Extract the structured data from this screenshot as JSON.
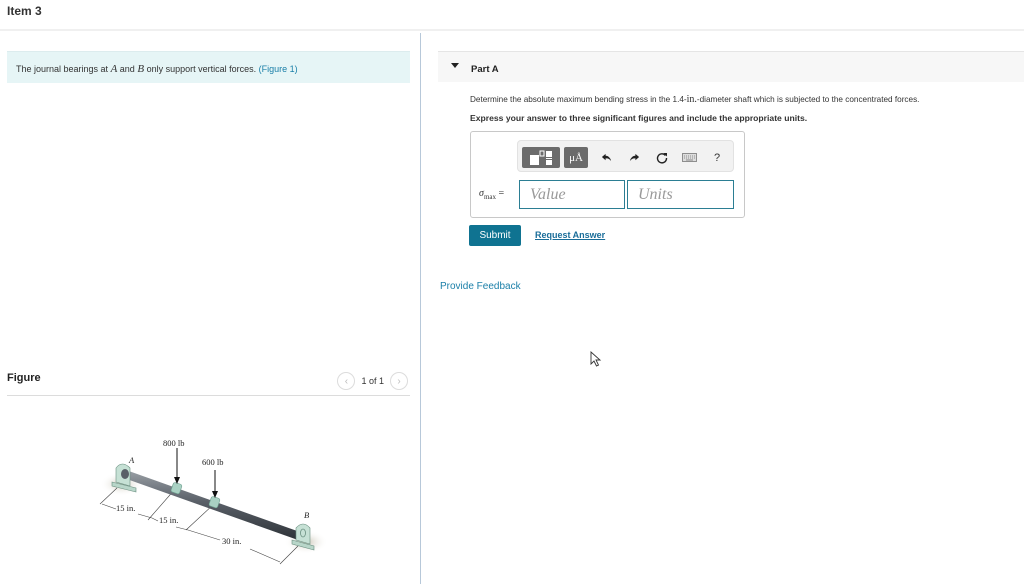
{
  "header": {
    "item_title": "Item 3"
  },
  "intro": {
    "text_before": "The journal bearings at ",
    "var_a": "A",
    "text_and": " and ",
    "var_b": "B",
    "text_after": " only support vertical forces. ",
    "figure_link": "(Figure 1)"
  },
  "figure_panel": {
    "title": "Figure",
    "pager_text": "1 of 1",
    "prev_icon": "chevron-left-icon",
    "next_icon": "chevron-right-icon",
    "labels": {
      "point_a": "A",
      "point_b": "B",
      "force_1": "800 lb",
      "force_2": "600 lb",
      "dim_1": "15 in.",
      "dim_2": "15 in.",
      "dim_3": "30 in."
    }
  },
  "part_a": {
    "label": "Part A",
    "question_before": "Determine the absolute maximum bending stress in the 1.4-",
    "question_unit": "in.",
    "question_after": "-diameter shaft which is subjected to the concentrated forces.",
    "instruction": "Express your answer to three significant figures and include the appropriate units.",
    "toolbar": {
      "templates_icon": "templates-icon",
      "units_label": "μÅ",
      "undo_icon": "undo-icon",
      "redo_icon": "redo-icon",
      "reset_icon": "reset-icon",
      "keyboard_icon": "keyboard-icon",
      "help_label": "?"
    },
    "variable_symbol": "σ",
    "variable_subscript": "max",
    "equals": " =",
    "value_placeholder": "Value",
    "units_placeholder": "Units",
    "value": "",
    "units": "",
    "submit_label": "Submit",
    "request_answer_label": "Request Answer"
  },
  "feedback_label": "Provide Feedback",
  "colors": {
    "accent": "#0f7391",
    "link": "#1a7fa8",
    "intro_bg": "#e6f5f6",
    "input_border": "#2b7e93"
  }
}
